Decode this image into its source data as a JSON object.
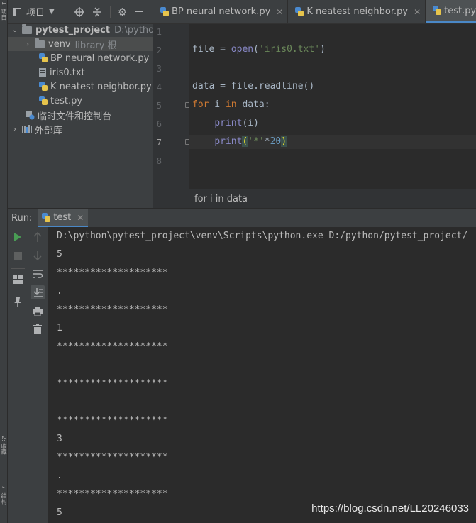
{
  "left_strip": {
    "top_label": "1: 项目",
    "bottom_label_1": "2: 收藏",
    "bottom_label_2": "7: 结构"
  },
  "project_panel": {
    "title": "项目",
    "icons": [
      "chevron-down-icon",
      "target-icon",
      "collapse-icon",
      "gear-icon",
      "minimize-icon"
    ],
    "tree": [
      {
        "label": "pytest_project",
        "suffix": "D:\\python\\p",
        "expanded": true,
        "type": "project-folder"
      },
      {
        "label": "venv",
        "suffix": "library 根",
        "expanded": false,
        "type": "folder",
        "selected": true
      },
      {
        "label": "BP neural network.py",
        "type": "py"
      },
      {
        "label": "iris0.txt",
        "type": "txt"
      },
      {
        "label": "K neatest neighbor.py",
        "type": "py"
      },
      {
        "label": "test.py",
        "type": "py"
      },
      {
        "label": "临时文件和控制台",
        "type": "scratch"
      },
      {
        "label": "外部库",
        "type": "libraries"
      }
    ]
  },
  "tabs": [
    {
      "label": "BP neural network.py",
      "active": false
    },
    {
      "label": "K neatest neighbor.py",
      "active": false
    },
    {
      "label": "test.py",
      "active": true
    }
  ],
  "editor": {
    "line_numbers": [
      "1",
      "2",
      "3",
      "4",
      "5",
      "6",
      "7",
      "8"
    ],
    "current_line": 7
  },
  "breadcrumb": "for i in data",
  "run_panel": {
    "label": "Run:",
    "config_tab": "test",
    "console_lines": [
      "D:\\python\\pytest_project\\venv\\Scripts\\python.exe D:/python/pytest_project/",
      "5",
      "********************",
      ".",
      "********************",
      "1",
      "********************",
      "",
      "********************",
      "",
      "********************",
      "3",
      "********************",
      ".",
      "********************",
      "5"
    ]
  },
  "watermark": "https://blog.csdn.net/LL20246033",
  "colors": {
    "background": "#2b2b2b",
    "panel": "#3c3f41",
    "keyword": "#cc7832",
    "builtin": "#8888c6",
    "string": "#6a8759",
    "number": "#6897bb",
    "run_green": "#499c54",
    "active_tab_underline": "#4a88c7"
  }
}
